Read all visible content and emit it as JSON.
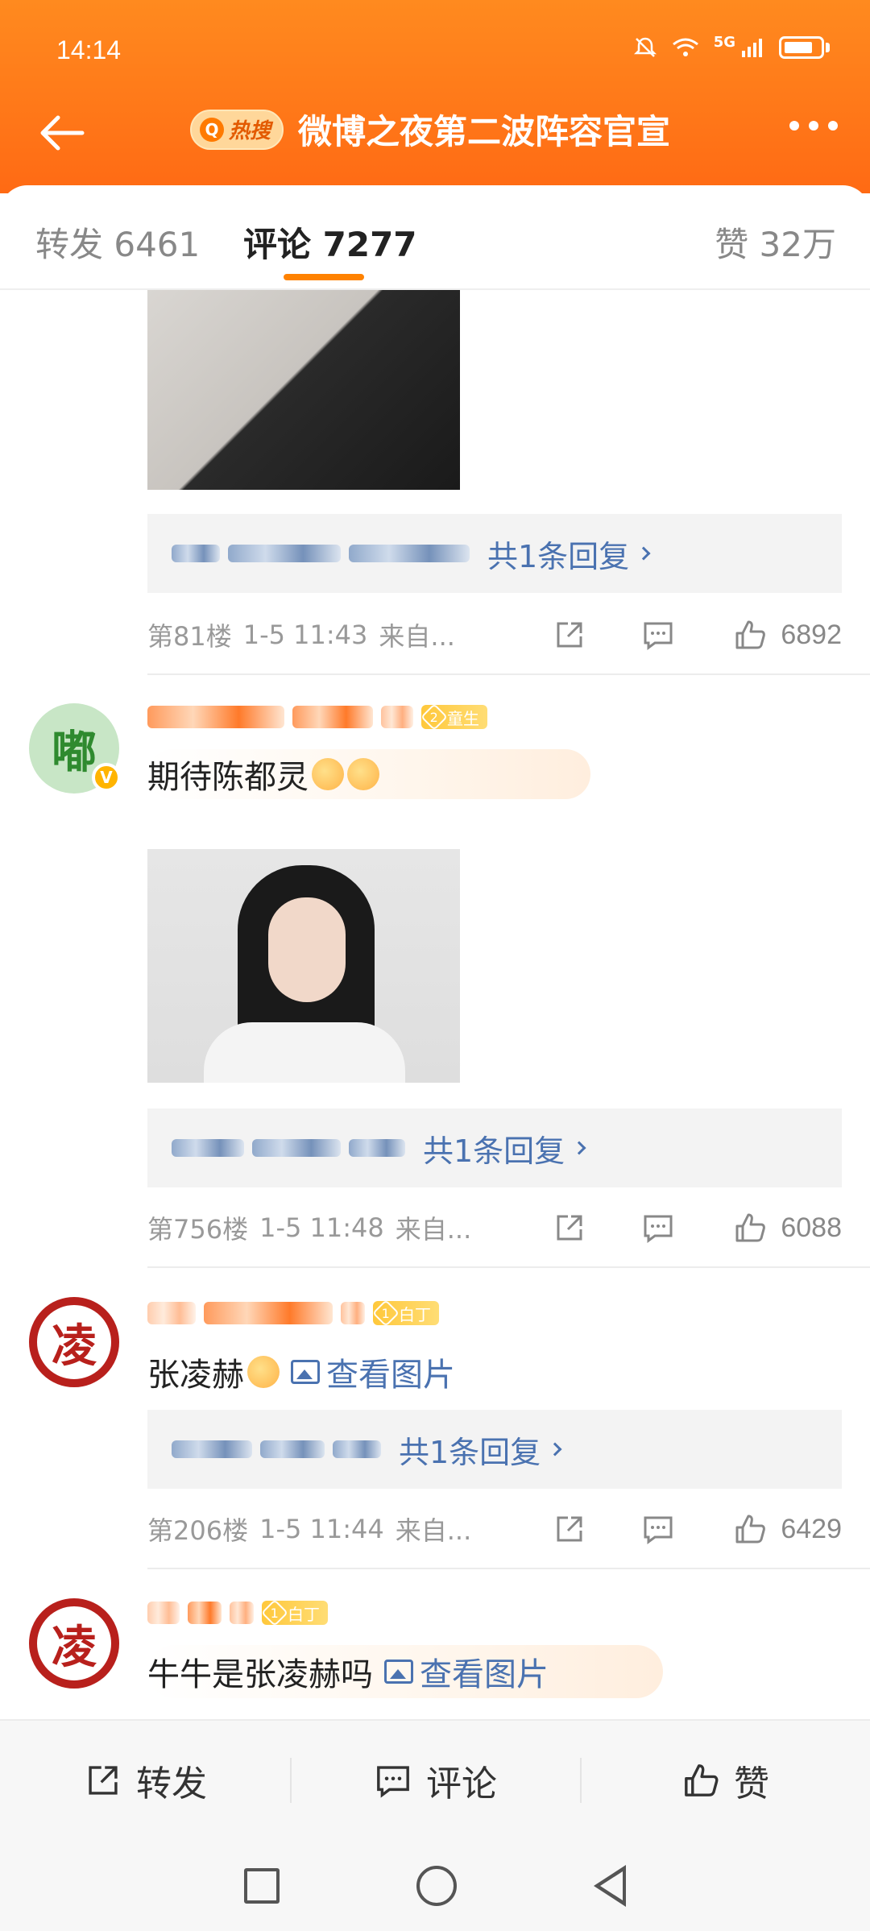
{
  "status_bar": {
    "time": "14:14",
    "network": "5G"
  },
  "header": {
    "hot_badge": "热搜",
    "title": "微博之夜第二波阵容官宣"
  },
  "tabs": [
    {
      "label": "转发 6461"
    },
    {
      "label": "评论 7277"
    },
    {
      "label": "赞 32万"
    }
  ],
  "comments": [
    {
      "reply_count": "共1条回复",
      "floor": "第81楼",
      "time": "1-5 11:43",
      "source": "来自...",
      "likes": "6892"
    },
    {
      "avatar_char": "嘟",
      "level": "2",
      "level_label": "童生",
      "text": "期待陈都灵",
      "reply_count": "共1条回复",
      "floor": "第756楼",
      "time": "1-5 11:48",
      "source": "来自...",
      "likes": "6088"
    },
    {
      "avatar_char": "凌",
      "level": "1",
      "level_label": "白丁",
      "text": "张凌赫",
      "view_image": "查看图片",
      "reply_count": "共1条回复",
      "floor": "第206楼",
      "time": "1-5 11:44",
      "source": "来自...",
      "likes": "6429"
    },
    {
      "avatar_char": "凌",
      "level": "1",
      "level_label": "白丁",
      "text": "牛牛是张凌赫吗",
      "view_image": "查看图片"
    }
  ],
  "action_bar": {
    "repost": "转发",
    "comment": "评论",
    "like": "赞"
  },
  "colors": {
    "brand_orange": "#ff7a1a",
    "link_blue": "#4a72b0",
    "tab_underline": "#ff8200"
  }
}
